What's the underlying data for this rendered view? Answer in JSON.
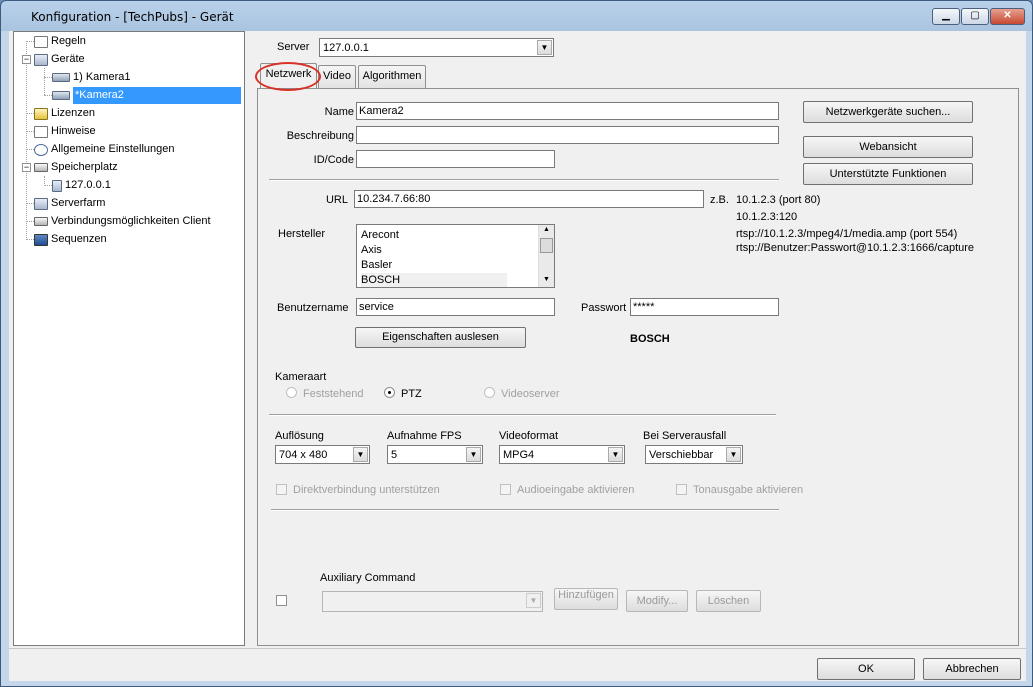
{
  "window": {
    "title": "Konfiguration - [TechPubs] - Gerät"
  },
  "tree": {
    "items": [
      {
        "label": "Regeln"
      },
      {
        "label": "Geräte"
      },
      {
        "label": "1) Kamera1"
      },
      {
        "label": "*Kamera2"
      },
      {
        "label": "Lizenzen"
      },
      {
        "label": "Hinweise"
      },
      {
        "label": "Allgemeine Einstellungen"
      },
      {
        "label": "Speicherplatz"
      },
      {
        "label": "127.0.0.1"
      },
      {
        "label": "Serverfarm"
      },
      {
        "label": "Verbindungsmöglichkeiten Client"
      },
      {
        "label": "Sequenzen"
      }
    ]
  },
  "server": {
    "label": "Server",
    "value": "127.0.0.1"
  },
  "tabs": [
    {
      "label": "Netzwerk"
    },
    {
      "label": "Video"
    },
    {
      "label": "Algorithmen"
    }
  ],
  "form": {
    "name_label": "Name",
    "name_value": "Kamera2",
    "desc_label": "Beschreibung",
    "desc_value": "",
    "id_label": "ID/Code",
    "id_value": "",
    "url_label": "URL",
    "url_value": "10.234.7.66:80",
    "zb_label": "z.B.",
    "examples": [
      "10.1.2.3 (port 80)",
      "10.1.2.3:120",
      "rtsp://10.1.2.3/mpeg4/1/media.amp (port 554)",
      "rtsp://Benutzer:Passwort@10.1.2.3:1666/capture"
    ],
    "manufacturer_label": "Hersteller",
    "manufacturers": [
      "Arecont",
      "Axis",
      "Basler",
      "BOSCH"
    ],
    "user_label": "Benutzername",
    "user_value": "service",
    "pass_label": "Passwort",
    "pass_value": "*****",
    "read_props_button": "Eigenschaften auslesen",
    "detected_vendor": "BOSCH"
  },
  "side_buttons": {
    "search": "Netzwerkgeräte suchen...",
    "web": "Webansicht",
    "functions": "Unterstützte Funktionen"
  },
  "camera_type": {
    "label": "Kameraart",
    "options": [
      {
        "label": "Feststehend"
      },
      {
        "label": "PTZ"
      },
      {
        "label": "Videoserver"
      }
    ]
  },
  "settings": {
    "resolution_label": "Auflösung",
    "resolution_value": "704 x 480",
    "fps_label": "Aufnahme FPS",
    "fps_value": "5",
    "format_label": "Videoformat",
    "format_value": "MPG4",
    "failover_label": "Bei Serverausfall",
    "failover_value": "Verschiebbar"
  },
  "checks": {
    "direct": "Direktverbindung unterstützen",
    "audio_in": "Audioeingabe aktivieren",
    "audio_out": "Tonausgabe aktivieren"
  },
  "aux": {
    "label": "Auxiliary Command",
    "add": "Hinzufügen",
    "modify": "Modify...",
    "delete": "Löschen"
  },
  "footer": {
    "ok": "OK",
    "cancel": "Abbrechen"
  }
}
